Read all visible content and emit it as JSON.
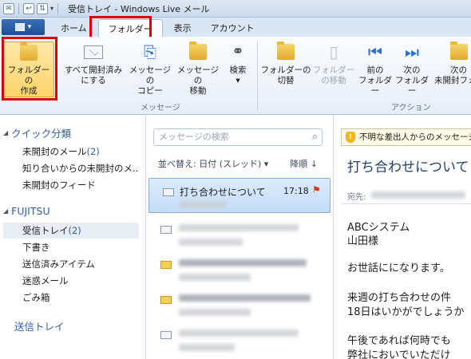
{
  "window": {
    "title": "受信トレイ - Windows Live メール"
  },
  "tabs": [
    "ホーム",
    "フォルダー",
    "表示",
    "アカウント"
  ],
  "ribbon": {
    "buttons": [
      {
        "label1": "フォルダーの",
        "label2": "作成"
      },
      {
        "label1": "すべて開封済み",
        "label2": "にする"
      },
      {
        "label1": "メッセージの",
        "label2": "コピー"
      },
      {
        "label1": "メッセージの",
        "label2": "移動"
      },
      {
        "label1": "検索",
        "label2": "▾"
      },
      {
        "label1": "フォルダーの",
        "label2": "切替"
      },
      {
        "label1": "フォルダー",
        "label2": "の移動"
      },
      {
        "label1": "前の",
        "label2": "フォルダー"
      },
      {
        "label1": "次の",
        "label2": "フォルダー"
      },
      {
        "label1": "次の",
        "label2": "未開封フォ"
      }
    ],
    "groups": {
      "message": "メッセージ",
      "action": "アクション"
    }
  },
  "sidebar": {
    "quick_head": "クイック分類",
    "quick_items": [
      {
        "label": "未開封のメール",
        "count": "(2)"
      },
      {
        "label": "知り合いからの未開封のメ...",
        "count": ""
      },
      {
        "label": "未開封のフィード",
        "count": ""
      }
    ],
    "account_head": "FUJITSU",
    "account_items": [
      {
        "label": "受信トレイ",
        "count": "(2)"
      },
      {
        "label": "下書き",
        "count": ""
      },
      {
        "label": "送信済みアイテム",
        "count": ""
      },
      {
        "label": "迷惑メール",
        "count": ""
      },
      {
        "label": "ごみ箱",
        "count": ""
      }
    ],
    "outbox": "送信トレイ"
  },
  "list": {
    "search_placeholder": "メッセージの検索",
    "sort_label": "並べ替え: 日付 (スレッド)",
    "sort_arrow": "▾",
    "sort_dir": "降順 ↓",
    "selected_message": {
      "subject": "打ち合わせについて",
      "time": "17:18",
      "flag": "⚑"
    }
  },
  "reading": {
    "warning": "不明な差出人からのメッセージ",
    "subject": "打ち合わせについて",
    "to_label": "宛先:",
    "body": [
      "ABCシステム",
      "山田様",
      "お世話にになります。",
      "来週の打ち合わせの件",
      "18日はいかがでしょうか",
      "午後であれば何時でも",
      "弊社においでいただけ"
    ]
  }
}
